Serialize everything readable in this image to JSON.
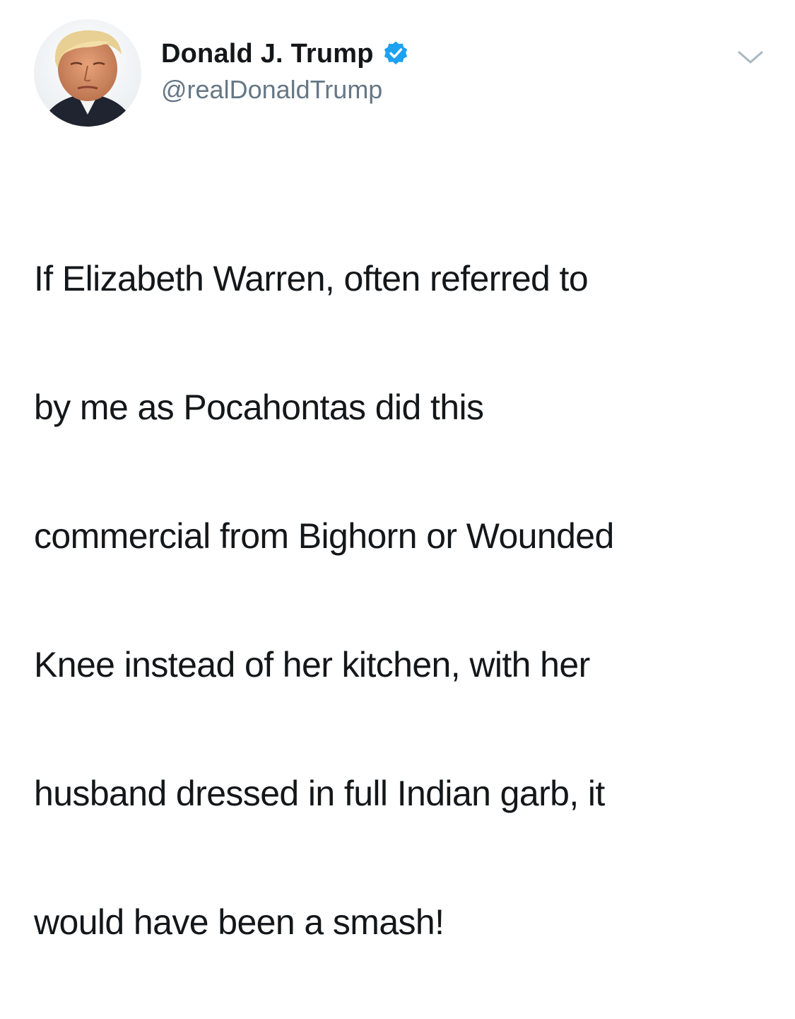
{
  "author": {
    "display_name": "Donald J. Trump",
    "handle": "@realDonaldTrump",
    "verified": true,
    "avatar_icon": "profile-photo",
    "verified_icon": "verified-badge-icon",
    "verified_color": "#1da1f2"
  },
  "tweet": {
    "text_lines": [
      "If Elizabeth Warren, often referred to",
      "by me as Pocahontas did this",
      "commercial from Bighorn or Wounded",
      "Knee instead of her kitchen, with her",
      "husband dressed in full Indian garb, it",
      "would have been a smash!"
    ]
  },
  "menu": {
    "icon": "chevron-down-icon"
  },
  "colors": {
    "text_primary": "#14171a",
    "text_secondary": "#657786",
    "background": "#ffffff",
    "chevron": "#aab8c2"
  }
}
